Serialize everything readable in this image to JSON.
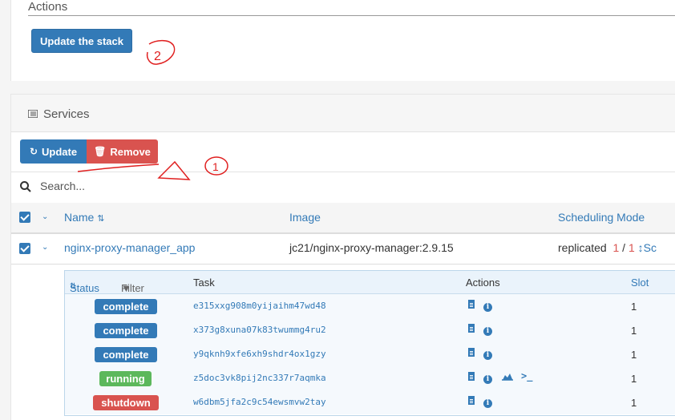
{
  "actions": {
    "title": "Actions",
    "update_stack_label": "Update the stack"
  },
  "services": {
    "title": "Services",
    "update_label": "Update",
    "remove_label": "Remove",
    "search_placeholder": "Search...",
    "columns": {
      "name": "Name",
      "image": "Image",
      "scheduling": "Scheduling Mode"
    },
    "rows": [
      {
        "name": "nginx-proxy-manager_app",
        "image": "jc21/nginx-proxy-manager:2.9.15",
        "mode": "replicated",
        "running": "1",
        "separator": "/",
        "desired": "1",
        "scale_label": "Sc"
      }
    ]
  },
  "tasks": {
    "columns": {
      "status": "Status",
      "filter": "Filter",
      "task": "Task",
      "actions": "Actions",
      "slot": "Slot"
    },
    "rows": [
      {
        "status": "complete",
        "id": "e315xxg908m0yijaihm47wd48",
        "slot": "1"
      },
      {
        "status": "complete",
        "id": "x373g8xuna07k83twummg4ru2",
        "slot": "1"
      },
      {
        "status": "complete",
        "id": "y9qknh9xfe6xh9shdr4ox1gzy",
        "slot": "1"
      },
      {
        "status": "running",
        "id": "z5doc3vk8pij2nc337r7aqmka",
        "slot": "1"
      },
      {
        "status": "shutdown",
        "id": "w6dbm5jfa2c9c54ewsmvw2tay",
        "slot": "1"
      }
    ]
  },
  "annotations": {
    "mark_1": "1",
    "mark_2": "2"
  },
  "colors": {
    "primary": "#337ab7",
    "danger": "#d9534f",
    "success": "#5cb85c",
    "annotation": "#e02020"
  }
}
